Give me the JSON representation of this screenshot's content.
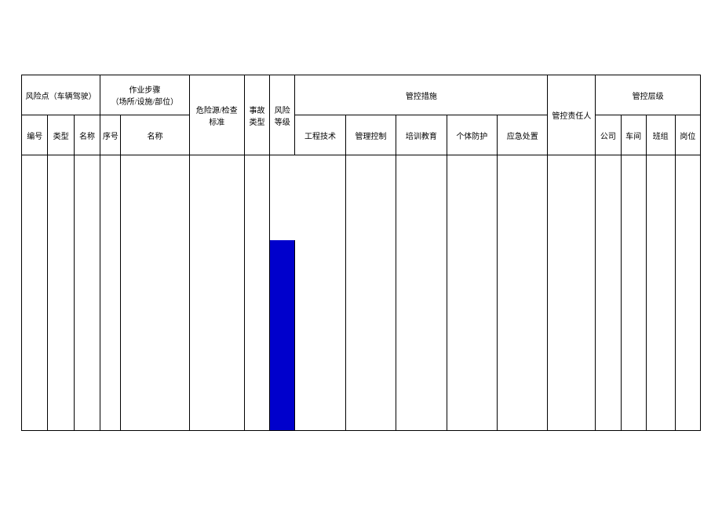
{
  "headers": {
    "risk_point_group": "风险点（车辆驾驶）",
    "risk_point_number": "编号",
    "risk_point_type": "类型",
    "risk_point_name": "名称",
    "operation_step_group": "作业步骤\n（场所/设施/部位）",
    "operation_step_seq": "序号",
    "operation_step_name": "名称",
    "hazard_standard": "危险源/检查\n标准",
    "accident_type": "事故\n类型",
    "risk_level": "风险\n等级",
    "control_measure_group": "管控措施",
    "control_measure_engineering": "工程技术",
    "control_measure_management": "管理控制",
    "control_measure_training": "培训教育",
    "control_measure_ppe": "个体防护",
    "control_measure_emergency": "应急处置",
    "control_responsible": "管控责任人",
    "control_level_group": "管控层级",
    "control_level_company": "公司",
    "control_level_workshop": "车间",
    "control_level_team": "班组",
    "control_level_post": "岗位"
  },
  "row": {
    "risk_point_number": "",
    "risk_point_type": "",
    "risk_point_name": "",
    "operation_step_seq": "",
    "operation_step_name": "",
    "hazard_standard": "",
    "accident_type": "",
    "risk_level": "",
    "control_measure_engineering": "",
    "control_measure_management": "",
    "control_measure_training": "",
    "control_measure_ppe": "",
    "control_measure_emergency": "",
    "control_responsible": "",
    "control_level_company": "",
    "control_level_workshop": "",
    "control_level_team": "",
    "control_level_post": ""
  }
}
